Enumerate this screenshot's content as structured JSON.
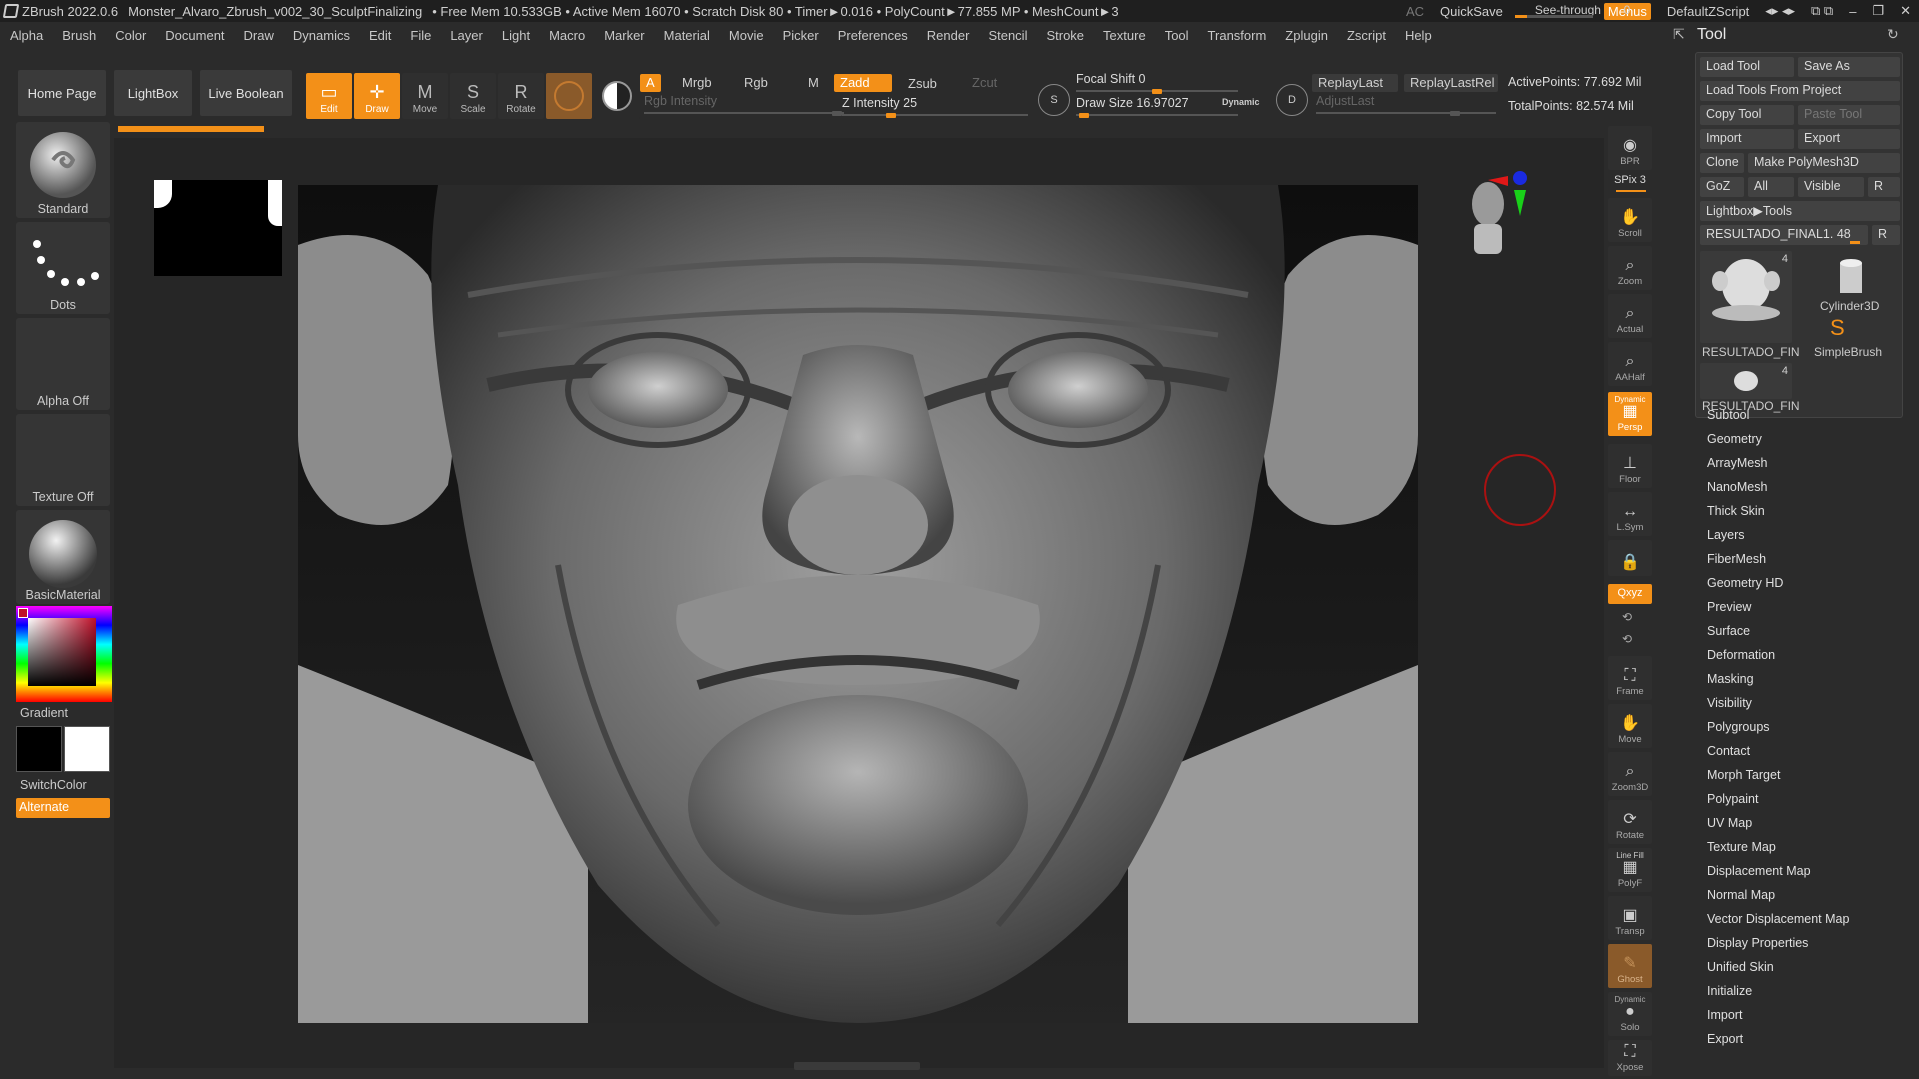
{
  "titlebar": {
    "app": "ZBrush 2022.0.6",
    "file": "Monster_Alvaro_Zbrush_v002_30_SculptFinalizing",
    "stats": "• Free Mem 10.533GB • Active Mem 16070 • Scratch Disk 80 • Timer►0.016 • PolyCount►77.855 MP • MeshCount►3",
    "ac": "AC",
    "quicksave": "QuickSave",
    "seethrough": "See-through",
    "seethrough_val": "0",
    "menus": "Menus",
    "script": "DefaultZScript"
  },
  "menubar": [
    "Alpha",
    "Brush",
    "Color",
    "Document",
    "Draw",
    "Dynamics",
    "Edit",
    "File",
    "Layer",
    "Light",
    "Macro",
    "Marker",
    "Material",
    "Movie",
    "Picker",
    "Preferences",
    "Render",
    "Stencil",
    "Stroke",
    "Texture",
    "Tool",
    "Transform",
    "Zplugin",
    "Zscript",
    "Help"
  ],
  "shelf": {
    "home": "Home Page",
    "lightbox": "LightBox",
    "liveboolean": "Live Boolean",
    "edit": "Edit",
    "draw": "Draw",
    "move": "Move",
    "scale": "Scale",
    "rotate": "Rotate",
    "a": "A",
    "mrgb": "Mrgb",
    "rgb": "Rgb",
    "m": "M",
    "zadd": "Zadd",
    "zsub": "Zsub",
    "zcut": "Zcut",
    "rgb_intensity": "Rgb Intensity",
    "z_intensity": "Z Intensity 25",
    "z_intensity_level": 0.25,
    "focal_shift": "Focal Shift 0",
    "focal_shift_level": 0.5,
    "draw_size": "Draw Size 16.97027",
    "draw_size_level": 0.02,
    "dynamic": "Dynamic",
    "replaylast": "ReplayLast",
    "replaylastrel": "ReplayLastRel",
    "adjustlast": "AdjustLast",
    "activepoints": "ActivePoints: 77.692 Mil",
    "totalpoints": "TotalPoints: 82.574 Mil"
  },
  "leftpanel": {
    "standard": "Standard",
    "dots": "Dots",
    "alpha_off": "Alpha Off",
    "texture_off": "Texture Off",
    "material": "BasicMaterial",
    "gradient": "Gradient",
    "switchcolor": "SwitchColor",
    "alternate": "Alternate"
  },
  "rightstrip": {
    "bpr": "BPR",
    "spix": "SPix 3",
    "scroll": "Scroll",
    "zoom": "Zoom",
    "actual": "Actual",
    "aahalf": "AAHalf",
    "dynamic": "Dynamic",
    "persp": "Persp",
    "floor": "Floor",
    "lsym": "L.Sym",
    "xyz": "Qxyz",
    "frame": "Frame",
    "move": "Move",
    "zoom3d": "Zoom3D",
    "rotate": "Rotate",
    "linefill": "Line Fill",
    "polyf": "PolyF",
    "transp": "Transp",
    "ghost": "Ghost",
    "solo": "Solo",
    "xpose": "Xpose"
  },
  "toolpalette": {
    "title": "Tool",
    "load_tool": "Load Tool",
    "save_as": "Save As",
    "load_from_project": "Load Tools From Project",
    "copy_tool": "Copy Tool",
    "paste_tool": "Paste Tool",
    "import": "Import",
    "export": "Export",
    "clone": "Clone",
    "make_polymesh": "Make PolyMesh3D",
    "goz": "GoZ",
    "all": "All",
    "visible": "Visible",
    "r": "R",
    "lightbox_tools": "Lightbox▶Tools",
    "current_tool": "RESULTADO_FINAL1. 48",
    "current_r": "R",
    "thumb1_label": "RESULTADO_FIN",
    "thumb1_count": "4",
    "thumb2_label": "Cylinder3D",
    "thumb3_label": "SimpleBrush",
    "thumb4_label": "RESULTADO_FIN",
    "thumb4_count": "4",
    "subpalettes": [
      "Subtool",
      "Geometry",
      "ArrayMesh",
      "NanoMesh",
      "Thick Skin",
      "Layers",
      "FiberMesh",
      "Geometry HD",
      "Preview",
      "Surface",
      "Deformation",
      "Masking",
      "Visibility",
      "Polygroups",
      "Contact",
      "Morph Target",
      "Polypaint",
      "UV Map",
      "Texture Map",
      "Displacement Map",
      "Normal Map",
      "Vector Displacement Map",
      "Display Properties",
      "Unified Skin",
      "Initialize",
      "Import",
      "Export"
    ]
  },
  "colors": {
    "accent": "#f39018",
    "panel": "#2b2b2b",
    "button": "#3a3a3a"
  }
}
